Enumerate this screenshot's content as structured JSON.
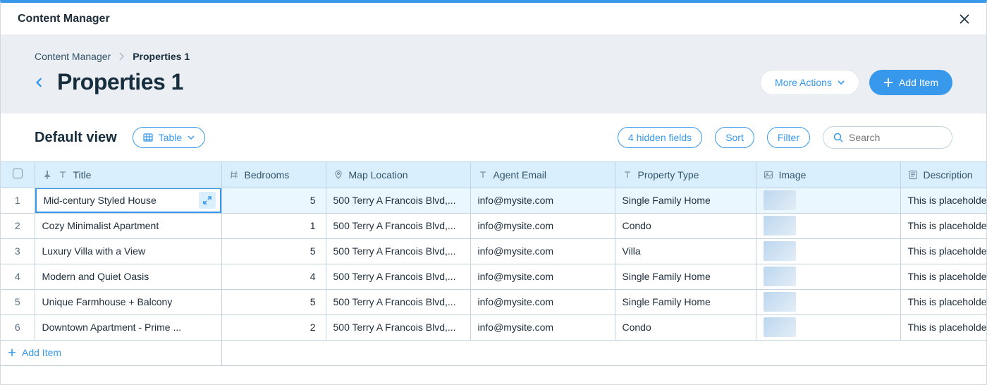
{
  "app_title": "Content Manager",
  "breadcrumb": {
    "root": "Content Manager",
    "current": "Properties 1"
  },
  "page_title": "Properties 1",
  "actions": {
    "more": "More Actions",
    "add": "Add Item"
  },
  "view": {
    "name": "Default view",
    "layout": "Table"
  },
  "controls": {
    "hidden_fields": "4 hidden fields",
    "sort": "Sort",
    "filter": "Filter",
    "search_placeholder": "Search"
  },
  "columns": {
    "title": "Title",
    "bedrooms": "Bedrooms",
    "location": "Map Location",
    "email": "Agent Email",
    "ptype": "Property Type",
    "image": "Image",
    "desc": "Description"
  },
  "rows": [
    {
      "n": "1",
      "title": "Mid-century Styled House",
      "bedrooms": "5",
      "location": "500 Terry A Francois Blvd,...",
      "email": "info@mysite.com",
      "ptype": "Single Family Home",
      "desc": "This is placeholde"
    },
    {
      "n": "2",
      "title": "Cozy Minimalist Apartment",
      "bedrooms": "1",
      "location": "500 Terry A Francois Blvd,...",
      "email": "info@mysite.com",
      "ptype": "Condo",
      "desc": "This is placeholde"
    },
    {
      "n": "3",
      "title": "Luxury Villa with a View",
      "bedrooms": "5",
      "location": "500 Terry A Francois Blvd,...",
      "email": "info@mysite.com",
      "ptype": "Villa",
      "desc": "This is placeholde"
    },
    {
      "n": "4",
      "title": "Modern and Quiet Oasis",
      "bedrooms": "4",
      "location": "500 Terry A Francois Blvd,...",
      "email": "info@mysite.com",
      "ptype": "Single Family Home",
      "desc": "This is placeholde"
    },
    {
      "n": "5",
      "title": "Unique Farmhouse + Balcony",
      "bedrooms": "5",
      "location": "500 Terry A Francois Blvd,...",
      "email": "info@mysite.com",
      "ptype": "Single Family Home",
      "desc": "This is placeholde"
    },
    {
      "n": "6",
      "title": "Downtown Apartment - Prime ...",
      "bedrooms": "2",
      "location": "500 Terry A Francois Blvd,...",
      "email": "info@mysite.com",
      "ptype": "Condo",
      "desc": "This is placeholde"
    }
  ],
  "footer": {
    "add_item": "Add Item"
  }
}
